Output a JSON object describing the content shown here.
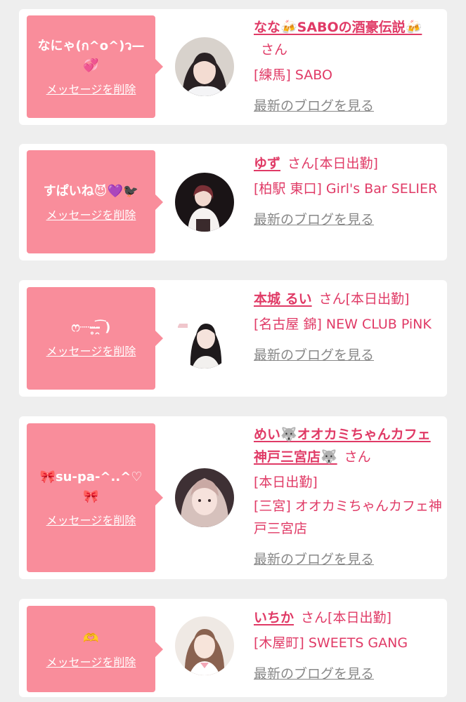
{
  "colors": {
    "background": "#eeeeee",
    "card": "#ffffff",
    "bubble": "#f98d9b",
    "accent": "#e03a66",
    "muted": "#888888"
  },
  "ui": {
    "delete_label": "メッセージを削除",
    "blog_label": "最新のブログを見る",
    "honorific": "さん"
  },
  "cards": [
    {
      "message": "なにゃ(ก^o^)ว—💞",
      "name": "なな🍻SABOの酒豪伝説🍻",
      "status": "",
      "shop": "[練馬] SABO"
    },
    {
      "message": "すぱいね😈💜🐦‍⬛",
      "name": "ゆず",
      "status": "[本日出勤]",
      "shop": "[柏駅 東口] Girl's Bar SELIER"
    },
    {
      "message": "ෆ┈┈̥-̶̯͡ )",
      "name": "本城 るい",
      "status": "[本日出勤]",
      "shop": "[名古屋 錦] NEW CLUB PiNK"
    },
    {
      "message": "🎀su-pa-^..^♡🎀",
      "name": "めい🐺オオカミちゃんカフェ神戸三宮店🐺",
      "status": "[本日出勤]",
      "shop": "[三宮] オオカミちゃんカフェ神戸三宮店"
    },
    {
      "message": "🫶",
      "name": "いちか",
      "status": "[本日出勤]",
      "shop": "[木屋町] SWEETS GANG"
    }
  ]
}
